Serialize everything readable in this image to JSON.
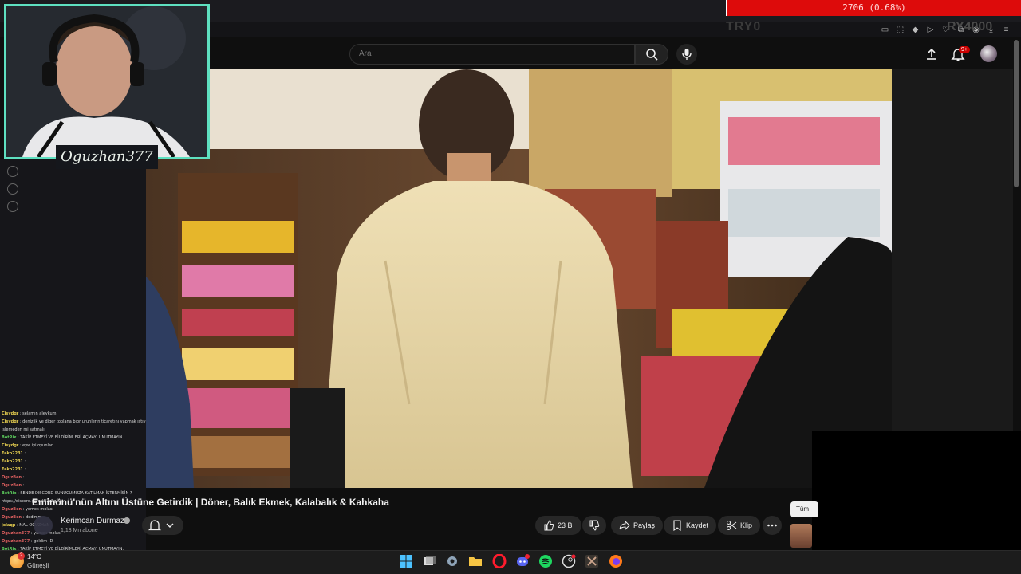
{
  "ticker": {
    "price_change": "2706 (0.68%)",
    "symbol": "TRY0",
    "symbol2": "RY4000"
  },
  "search": {
    "placeholder": "Ara"
  },
  "notifications": {
    "badge": "9+"
  },
  "webcam": {
    "name": "Oguzhan377"
  },
  "video": {
    "title": "Eminönü'nün Altını Üstüne Getirdik | Döner, Balık Ekmek, Kalabalık & Kahkaha",
    "channel": "Kerimcan Durmaz",
    "subscribers": "1,18 Mn abone",
    "likes": "23 B",
    "share_label": "Paylaş",
    "save_label": "Kaydet",
    "clip_label": "Klip",
    "tooltip": "Tüm"
  },
  "chat": [
    {
      "user": "Cisydgr",
      "color": "yellow",
      "msg": "selamın aleykum"
    },
    {
      "user": "Cisydgr",
      "color": "yellow",
      "msg": "denizlik ve diger toplana bıbr urunlerın ticaretını yapmak ıstıyorum topladıklarını"
    },
    {
      "user": "",
      "color": "yellow",
      "msg": "işlemeden mi satmalı"
    },
    {
      "user": "BotRix",
      "color": "green",
      "msg": "TAKİP ETMEYİ VE BİLDİRİMLERİ AÇMAYI UNUTMAYIN."
    },
    {
      "user": "Cisydgr",
      "color": "yellow",
      "msg": "eyw iyi oyunlar"
    },
    {
      "user": "Fako2231",
      "color": "yellow",
      "msg": ""
    },
    {
      "user": "Fako2231",
      "color": "yellow",
      "msg": ""
    },
    {
      "user": "Fako2231",
      "color": "yellow",
      "msg": ""
    },
    {
      "user": "OguzBen",
      "color": "red",
      "msg": ""
    },
    {
      "user": "OguzBen",
      "color": "red",
      "msg": ""
    },
    {
      "user": "BotRix",
      "color": "green",
      "msg": "SENDE DISCORD SUNUCUMUZA KATILMAK İSTERMİSİN ?"
    },
    {
      "user": "",
      "color": "yellow",
      "msg": "https://discord.gg/oUQ2z5gUXt"
    },
    {
      "user": "OguzBen",
      "color": "red",
      "msg": "yemek molası"
    },
    {
      "user": "OguzBen",
      "color": "red",
      "msg": "dedimm"
    },
    {
      "user": "jelaqp",
      "color": "yellow",
      "msg": "MAL OGUZHAN"
    },
    {
      "user": "Oguzhan377",
      "color": "red",
      "msg": "yemek molası"
    },
    {
      "user": "Oguzhan377",
      "color": "red",
      "msg": "geldim :D"
    },
    {
      "user": "BotRix",
      "color": "green",
      "msg": "TAKİP ETMEYİ VE BİLDİRİMLERİ AÇMAYI UNUTMAYIN."
    }
  ],
  "weather": {
    "temp": "14°C",
    "desc": "Güneşli",
    "badge": "2"
  },
  "colors": {
    "accent_cam": "#5ee0c0",
    "ticker_bg": "#dd0b0b",
    "yt_red": "#cc0000"
  }
}
